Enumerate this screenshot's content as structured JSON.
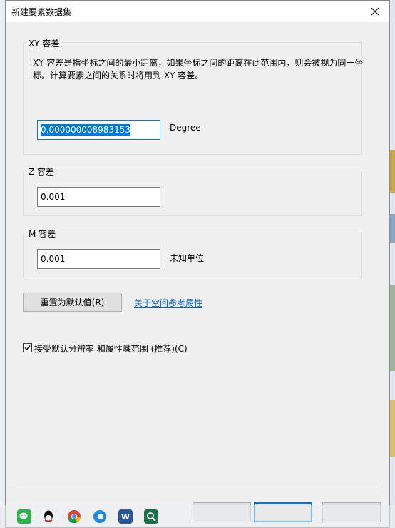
{
  "dialog": {
    "title": "新建要素数据集",
    "close_glyph": "✕"
  },
  "xy_group": {
    "label": "XY 容差",
    "description": "XY 容差是指坐标之间的最小距离，如果坐标之间的距离在此范围内，则会被视为同一坐标。计算要素之间的关系时将用到 XY 容差。",
    "value": "0.000000008983153",
    "unit": "Degree"
  },
  "z_group": {
    "label": "Z 容差",
    "value": "0.001"
  },
  "m_group": {
    "label": "M 容差",
    "value": "0.001",
    "unit": "未知单位"
  },
  "reset_button": {
    "label": "重置为默认值(R)"
  },
  "spatial_ref_link": {
    "label": "关于空间参考属性"
  },
  "accept_checkbox": {
    "checked": true,
    "label": "接受默认分辨率 和属性域范围 (推荐)(C)"
  },
  "colors": {
    "accent": "#0078d7",
    "link": "#0066cc",
    "dialog_bg": "#f0f0f0"
  },
  "taskbar": {
    "icons": [
      "wechat-icon",
      "qq-icon",
      "chrome-icon",
      "edge-icon",
      "word-icon",
      "search-app-icon"
    ]
  }
}
